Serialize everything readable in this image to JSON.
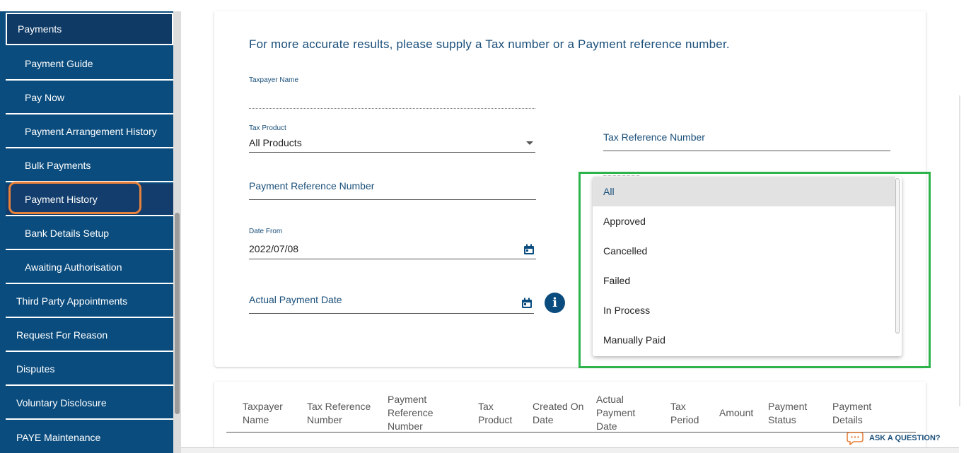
{
  "sidebar": {
    "items": [
      {
        "label": "Payments",
        "level": "top",
        "state": "active"
      },
      {
        "label": "Payment Guide",
        "level": "sub"
      },
      {
        "label": "Pay Now",
        "level": "sub"
      },
      {
        "label": "Payment Arrangement History",
        "level": "sub"
      },
      {
        "label": "Bulk Payments",
        "level": "sub"
      },
      {
        "label": "Payment History",
        "level": "sub",
        "state": "highlighted"
      },
      {
        "label": "Bank Details Setup",
        "level": "sub"
      },
      {
        "label": "Awaiting Authorisation",
        "level": "sub"
      },
      {
        "label": "Third Party Appointments",
        "level": "top"
      },
      {
        "label": "Request For Reason",
        "level": "top"
      },
      {
        "label": "Disputes",
        "level": "top"
      },
      {
        "label": "Voluntary Disclosure",
        "level": "top"
      },
      {
        "label": "PAYE Maintenance",
        "level": "top"
      }
    ]
  },
  "form": {
    "heading": "For more accurate results, please supply a Tax number or a Payment reference number.",
    "taxpayer_name": {
      "label": "Taxpayer Name",
      "value": ""
    },
    "tax_product": {
      "label": "Tax Product",
      "value": "All Products"
    },
    "tax_reference_number": {
      "placeholder": "Tax Reference Number"
    },
    "payment_reference_number": {
      "placeholder": "Payment Reference Number"
    },
    "date_from": {
      "label": "Date From",
      "value": "2022/07/08"
    },
    "actual_payment_date": {
      "placeholder": "Actual Payment Date"
    }
  },
  "status_dropdown": {
    "options": [
      {
        "label": "All",
        "selected": true
      },
      {
        "label": "Approved"
      },
      {
        "label": "Cancelled"
      },
      {
        "label": "Failed"
      },
      {
        "label": "In Process"
      },
      {
        "label": "Manually Paid"
      }
    ]
  },
  "table": {
    "columns": [
      [
        "Taxpayer",
        "Name"
      ],
      [
        "Tax Reference",
        "Number"
      ],
      [
        "Payment",
        "Reference",
        "Number"
      ],
      [
        "Tax",
        "Product"
      ],
      [
        "Created On",
        "Date"
      ],
      [
        "Actual",
        "Payment",
        "Date"
      ],
      [
        "Tax",
        "Period"
      ],
      [
        "Amount"
      ],
      [
        "Payment",
        "Status"
      ],
      [
        "Payment",
        "Details"
      ]
    ]
  },
  "help": {
    "ask_label": "ASK A QUESTION?"
  },
  "colors": {
    "sidebar_bg": "#0a4c7e",
    "sidebar_active": "#0f3a66",
    "heading_text": "#1a4f7a",
    "annotation_orange": "#e8813a",
    "annotation_green": "#2db34a"
  }
}
